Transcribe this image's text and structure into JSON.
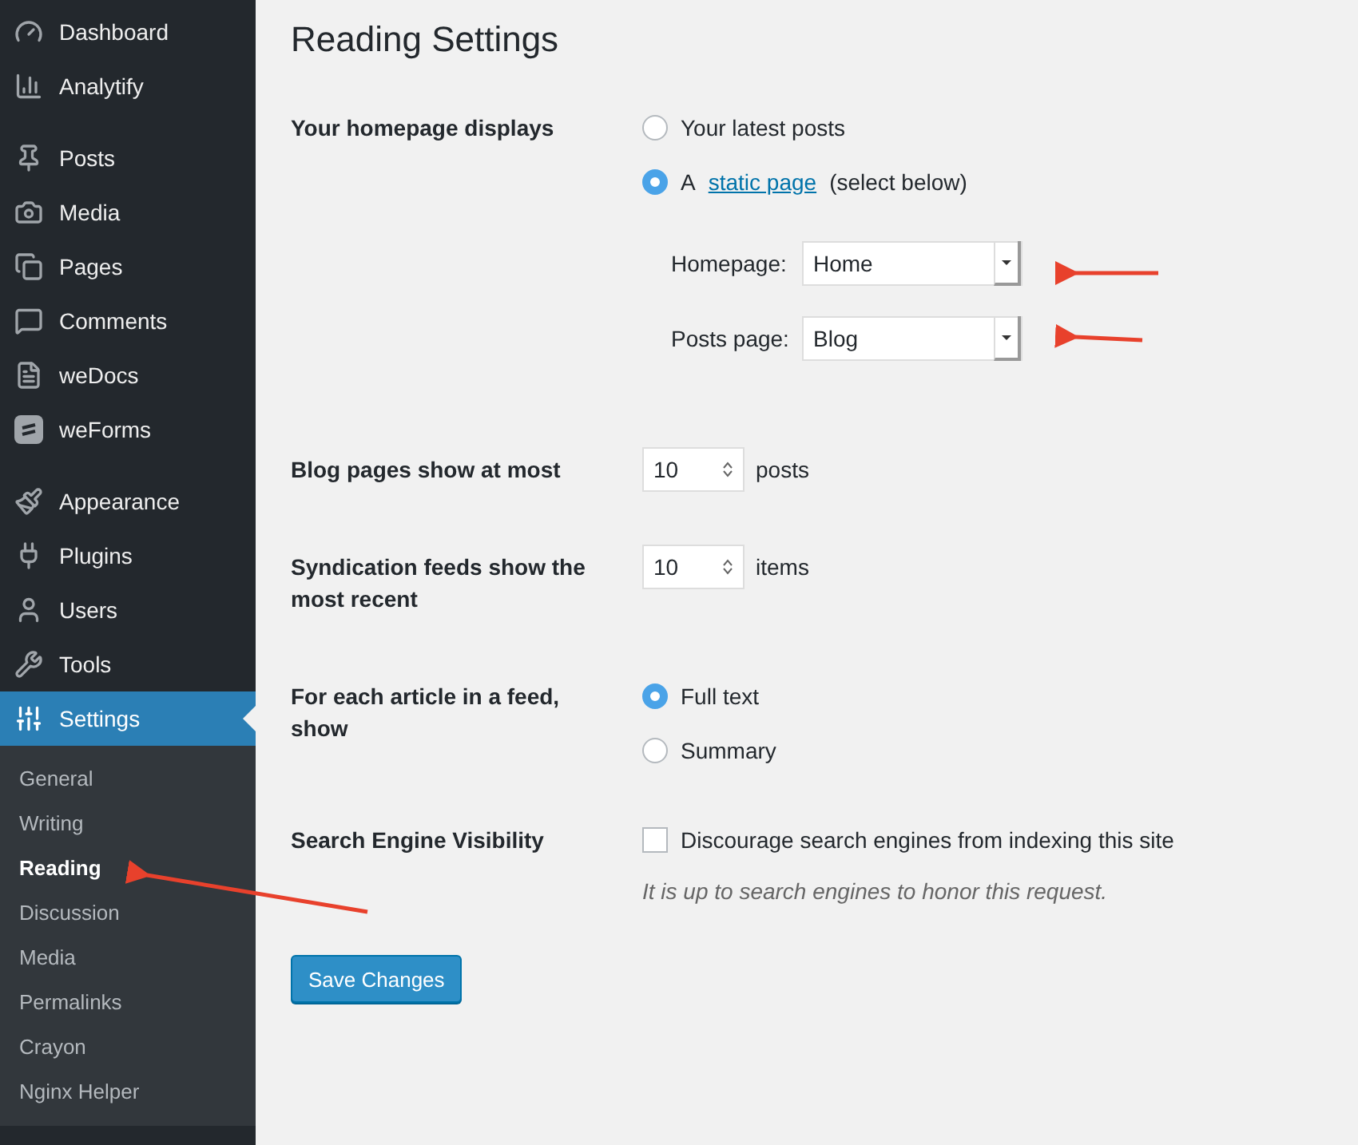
{
  "sidebar": {
    "menu_groups": [
      [
        {
          "label": "Dashboard",
          "kind": "dashboard",
          "selected": false
        },
        {
          "label": "Analytify",
          "kind": "analytics",
          "selected": false
        }
      ],
      [
        {
          "label": "Posts",
          "kind": "posts",
          "selected": false
        },
        {
          "label": "Media",
          "kind": "media",
          "selected": false
        },
        {
          "label": "Pages",
          "kind": "pages",
          "selected": false
        },
        {
          "label": "Comments",
          "kind": "comments",
          "selected": false
        },
        {
          "label": "weDocs",
          "kind": "docs",
          "selected": false
        },
        {
          "label": "weForms",
          "kind": "forms",
          "selected": false
        }
      ],
      [
        {
          "label": "Appearance",
          "kind": "appearance",
          "selected": false
        },
        {
          "label": "Plugins",
          "kind": "plugins",
          "selected": false
        },
        {
          "label": "Users",
          "kind": "users",
          "selected": false
        },
        {
          "label": "Tools",
          "kind": "tools",
          "selected": false
        },
        {
          "label": "Settings",
          "kind": "settings",
          "selected": true
        }
      ]
    ],
    "submenu": [
      {
        "label": "General",
        "selected": false
      },
      {
        "label": "Writing",
        "selected": false
      },
      {
        "label": "Reading",
        "selected": true
      },
      {
        "label": "Discussion",
        "selected": false
      },
      {
        "label": "Media",
        "selected": false
      },
      {
        "label": "Permalinks",
        "selected": false
      },
      {
        "label": "Crayon",
        "selected": false
      },
      {
        "label": "Nginx Helper",
        "selected": false
      }
    ]
  },
  "page": {
    "title": "Reading Settings",
    "rows": [
      {
        "kind": "radio",
        "label": "Your homepage displays",
        "options": [
          {
            "before": "Your latest posts",
            "selected": false
          },
          {
            "before": "A",
            "link": "static page",
            "after": "(select below)",
            "selected": true
          }
        ],
        "selects": [
          {
            "label": "Homepage:",
            "value": "Home"
          },
          {
            "label": "Posts page:",
            "value": "Blog"
          }
        ]
      },
      {
        "kind": "number",
        "label": "Blog pages show at most",
        "value": "10",
        "unit": "posts"
      },
      {
        "kind": "number",
        "label": "Syndication feeds show the most recent",
        "value": "10",
        "unit": "items"
      },
      {
        "kind": "radio",
        "label": "For each article in a feed, show",
        "options": [
          {
            "before": "Full text",
            "selected": true
          },
          {
            "before": "Summary",
            "selected": false
          }
        ]
      },
      {
        "kind": "checkbox",
        "label": "Search Engine Visibility",
        "text": "Discourage search engines from indexing this site",
        "checked": false,
        "note": "It is up to search engines to honor this request."
      }
    ],
    "button": "Save Changes"
  }
}
